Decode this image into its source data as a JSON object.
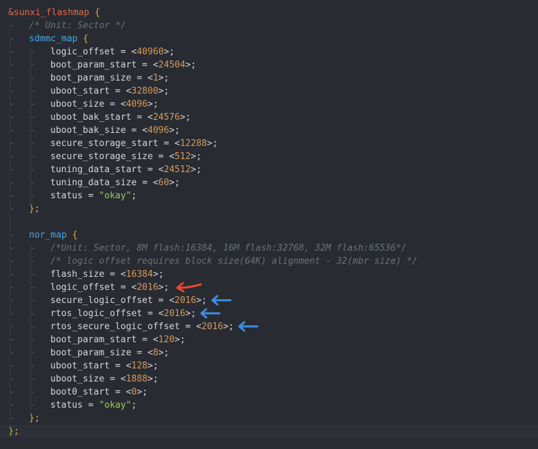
{
  "root": {
    "label": "&sunxi_flashmap",
    "open": " {",
    "close": "};"
  },
  "comment_unit": "/* Unit: Sector */",
  "sdmmc": {
    "name": "sdmmc_map",
    "open": " {",
    "close": "};",
    "props": [
      {
        "key": "logic_offset",
        "value": "40960"
      },
      {
        "key": "boot_param_start",
        "value": "24504"
      },
      {
        "key": "boot_param_size",
        "value": "1"
      },
      {
        "key": "uboot_start",
        "value": "32800"
      },
      {
        "key": "uboot_size",
        "value": "4096"
      },
      {
        "key": "uboot_bak_start",
        "value": "24576"
      },
      {
        "key": "uboot_bak_size",
        "value": "4096"
      },
      {
        "key": "secure_storage_start",
        "value": "12288"
      },
      {
        "key": "secure_storage_size",
        "value": "512"
      },
      {
        "key": "tuning_data_start",
        "value": "24512"
      },
      {
        "key": "tuning_data_size",
        "value": "60"
      }
    ],
    "status_key": "status",
    "status_value": "\"okay\""
  },
  "nor": {
    "name": "nor_map",
    "open": " {",
    "close": "};",
    "comment1": "/*Unit: Sector, 8M flash:16384, 16M flash:32768, 32M flash:65536*/",
    "comment2": "/* logic offset requires block size(64K) alignment - 32(mbr size) */",
    "props": [
      {
        "key": "flash_size",
        "value": "16384"
      },
      {
        "key": "logic_offset",
        "value": "2016"
      },
      {
        "key": "secure_logic_offset",
        "value": "2016"
      },
      {
        "key": "rtos_logic_offset",
        "value": "2016"
      },
      {
        "key": "rtos_secure_logic_offset",
        "value": "2016"
      },
      {
        "key": "boot_param_start",
        "value": "120"
      },
      {
        "key": "boot_param_size",
        "value": "8"
      },
      {
        "key": "uboot_start",
        "value": "128"
      },
      {
        "key": "uboot_size",
        "value": "1888"
      },
      {
        "key": "boot0_start",
        "value": "0"
      }
    ],
    "status_key": "status",
    "status_value": "\"okay\""
  },
  "syntax": {
    "eq": " = ",
    "lt": "<",
    "gt": ">",
    "semi": ";"
  },
  "annotations": [
    {
      "target": "nor.logic_offset",
      "color": "#e8472f",
      "icon": "arrow-left-icon"
    },
    {
      "target": "nor.secure_logic_offset",
      "color": "#3d8fe0",
      "icon": "arrow-left-icon"
    },
    {
      "target": "nor.rtos_logic_offset",
      "color": "#3d8fe0",
      "icon": "arrow-left-icon"
    },
    {
      "target": "nor.rtos_secure_logic_offset",
      "color": "#3d8fe0",
      "icon": "arrow-left-icon"
    }
  ],
  "colors": {
    "background": "#282b31",
    "label": "#e0694e",
    "node": "#4aa5e8",
    "brace": "#d9b04a",
    "number": "#d99a5c",
    "string": "#9ccc65",
    "comment": "#6c7079"
  }
}
